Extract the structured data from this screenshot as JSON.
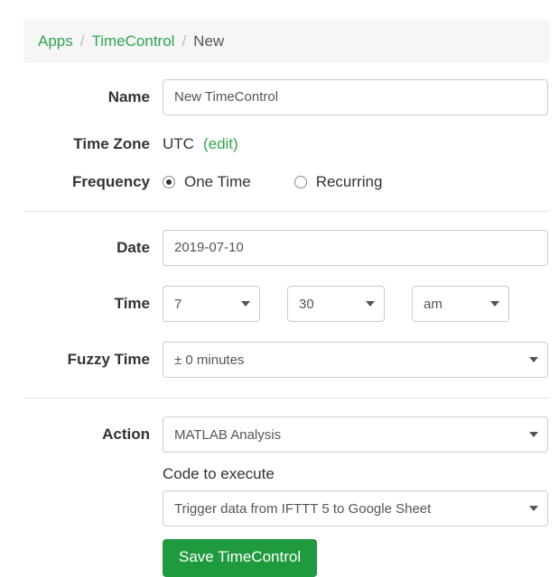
{
  "breadcrumb": {
    "apps": "Apps",
    "timecontrol": "TimeControl",
    "current": "New"
  },
  "labels": {
    "name": "Name",
    "timezone": "Time Zone",
    "frequency": "Frequency",
    "date": "Date",
    "time": "Time",
    "fuzzy": "Fuzzy Time",
    "action": "Action",
    "code_to_execute": "Code to execute"
  },
  "fields": {
    "name_value": "New TimeControl",
    "timezone_value": "UTC",
    "timezone_edit": "(edit)",
    "freq_one_time": "One Time",
    "freq_recurring": "Recurring",
    "date_value": "2019-07-10",
    "time_hour": "7",
    "time_minute": "30",
    "time_ampm": "am",
    "fuzzy_value": "± 0 minutes",
    "action_value": "MATLAB Analysis",
    "code_value": "Trigger data from IFTTT 5 to Google Sheet"
  },
  "buttons": {
    "save": "Save TimeControl"
  }
}
